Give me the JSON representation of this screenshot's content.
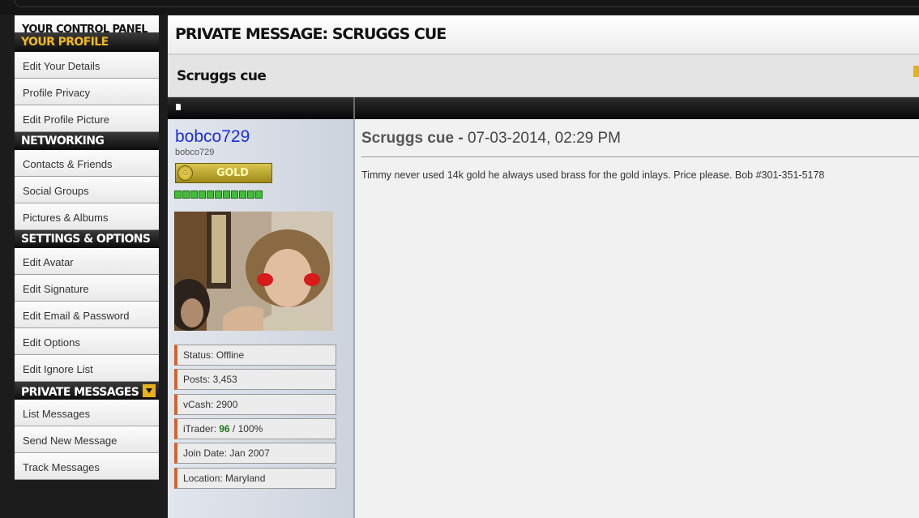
{
  "sidebar": {
    "header": "YOUR CONTROL PANEL",
    "sections": [
      {
        "title": "YOUR PROFILE",
        "items": [
          "Edit Your Details",
          "Profile Privacy",
          "Edit Profile Picture"
        ]
      },
      {
        "title": "NETWORKING",
        "items": [
          "Contacts & Friends",
          "Social Groups",
          "Pictures & Albums"
        ]
      },
      {
        "title": "SETTINGS & OPTIONS",
        "items": [
          "Edit Avatar",
          "Edit Signature",
          "Edit Email & Password",
          "Edit Options",
          "Edit Ignore List"
        ]
      },
      {
        "title": "PRIVATE MESSAGES",
        "items": [
          "List Messages",
          "Send New Message",
          "Track Messages"
        ]
      }
    ]
  },
  "main": {
    "page_title": "PRIVATE MESSAGE: SCRUGGS CUE",
    "subject": "Scruggs cue"
  },
  "user": {
    "username": "bobco729",
    "user_title": "bobco729",
    "rank": "GOLD",
    "rep_pips": 11,
    "status_label": "Status: Offline",
    "posts_label": "Posts: 3,453",
    "vcash_label": "vCash: 2900",
    "itrader_prefix": "iTrader: ",
    "itrader_score": "96",
    "itrader_suffix": " / 100%",
    "join_date_label": "Join Date: Jan 2007",
    "location_label": "Location: Maryland"
  },
  "message": {
    "title": "Scruggs cue",
    "separator": " - ",
    "date": "07-03-2014, 02:29 PM",
    "body": "Timmy never used 14k gold he always used brass for the gold inlays. Price please. Bob #301-351-5178"
  },
  "colors": {
    "accent_gold": "#f2b91c",
    "username_blue": "#1a2ee0",
    "stat_border_orange": "#d3632b"
  }
}
